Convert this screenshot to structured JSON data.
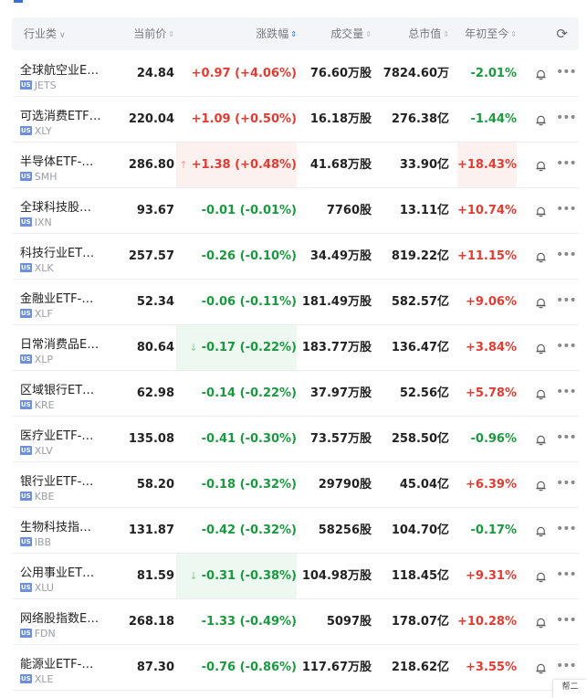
{
  "header": {
    "industry": "行业类",
    "price": "当前价",
    "change": "涨跌幅",
    "volume": "成交量",
    "market_cap": "总市值",
    "ytd": "年初至今",
    "refresh_icon": "refresh-icon",
    "sort_active": "change"
  },
  "market_badge": "US",
  "rows": [
    {
      "name": "全球航空业E…",
      "ticker": "JETS",
      "price": "24.84",
      "change": "+0.97 (+4.06%)",
      "dir": "up",
      "volume": "76.60万股",
      "cap": "7824.60万",
      "ytd": "-2.01%",
      "ytd_dir": "down",
      "highlight": "",
      "ytd_highlight": false
    },
    {
      "name": "可选消费ETF…",
      "ticker": "XLY",
      "price": "220.04",
      "change": "+1.09 (+0.50%)",
      "dir": "up",
      "volume": "16.18万股",
      "cap": "276.38亿",
      "ytd": "-1.44%",
      "ytd_dir": "down",
      "highlight": "",
      "ytd_highlight": false
    },
    {
      "name": "半导体ETF-…",
      "ticker": "SMH",
      "price": "286.80",
      "change": "+1.38 (+0.48%)",
      "dir": "up",
      "volume": "41.68万股",
      "cap": "33.90亿",
      "ytd": "+18.43%",
      "ytd_dir": "up",
      "highlight": "red",
      "ytd_highlight": true
    },
    {
      "name": "全球科技股…",
      "ticker": "IXN",
      "price": "93.67",
      "change": "-0.01 (-0.01%)",
      "dir": "down",
      "volume": "7760股",
      "cap": "13.11亿",
      "ytd": "+10.74%",
      "ytd_dir": "up",
      "highlight": "",
      "ytd_highlight": false
    },
    {
      "name": "科技行业ET…",
      "ticker": "XLK",
      "price": "257.57",
      "change": "-0.26 (-0.10%)",
      "dir": "down",
      "volume": "34.49万股",
      "cap": "819.22亿",
      "ytd": "+11.15%",
      "ytd_dir": "up",
      "highlight": "",
      "ytd_highlight": false
    },
    {
      "name": "金融业ETF-…",
      "ticker": "XLF",
      "price": "52.34",
      "change": "-0.06 (-0.11%)",
      "dir": "down",
      "volume": "181.49万股",
      "cap": "582.57亿",
      "ytd": "+9.06%",
      "ytd_dir": "up",
      "highlight": "",
      "ytd_highlight": false
    },
    {
      "name": "日常消费品E…",
      "ticker": "XLP",
      "price": "80.64",
      "change": "-0.17 (-0.22%)",
      "dir": "down",
      "volume": "183.77万股",
      "cap": "136.47亿",
      "ytd": "+3.84%",
      "ytd_dir": "up",
      "highlight": "green",
      "ytd_highlight": false
    },
    {
      "name": "区域银行ET…",
      "ticker": "KRE",
      "price": "62.98",
      "change": "-0.14 (-0.22%)",
      "dir": "down",
      "volume": "37.97万股",
      "cap": "52.56亿",
      "ytd": "+5.78%",
      "ytd_dir": "up",
      "highlight": "",
      "ytd_highlight": false
    },
    {
      "name": "医疗业ETF-…",
      "ticker": "XLV",
      "price": "135.08",
      "change": "-0.41 (-0.30%)",
      "dir": "down",
      "volume": "73.57万股",
      "cap": "258.50亿",
      "ytd": "-0.96%",
      "ytd_dir": "down",
      "highlight": "",
      "ytd_highlight": false
    },
    {
      "name": "银行业ETF-…",
      "ticker": "KBE",
      "price": "58.20",
      "change": "-0.18 (-0.32%)",
      "dir": "down",
      "volume": "29790股",
      "cap": "45.04亿",
      "ytd": "+6.39%",
      "ytd_dir": "up",
      "highlight": "",
      "ytd_highlight": false
    },
    {
      "name": "生物科技指…",
      "ticker": "IBB",
      "price": "131.87",
      "change": "-0.42 (-0.32%)",
      "dir": "down",
      "volume": "58256股",
      "cap": "104.70亿",
      "ytd": "-0.17%",
      "ytd_dir": "down",
      "highlight": "",
      "ytd_highlight": false
    },
    {
      "name": "公用事业ET…",
      "ticker": "XLU",
      "price": "81.59",
      "change": "-0.31 (-0.38%)",
      "dir": "down",
      "volume": "104.98万股",
      "cap": "118.45亿",
      "ytd": "+9.31%",
      "ytd_dir": "up",
      "highlight": "green",
      "ytd_highlight": false
    },
    {
      "name": "网络股指数E…",
      "ticker": "FDN",
      "price": "268.18",
      "change": "-1.33 (-0.49%)",
      "dir": "down",
      "volume": "5097股",
      "cap": "178.07亿",
      "ytd": "+10.28%",
      "ytd_dir": "up",
      "highlight": "",
      "ytd_highlight": false
    },
    {
      "name": "能源业ETF-…",
      "ticker": "XLE",
      "price": "87.30",
      "change": "-0.76 (-0.86%)",
      "dir": "down",
      "volume": "117.67万股",
      "cap": "218.62亿",
      "ytd": "+3.55%",
      "ytd_dir": "up",
      "highlight": "",
      "ytd_highlight": false
    }
  ],
  "row_icons": {
    "alert": "bell-icon",
    "more": "more-icon"
  },
  "float_button": "帮二"
}
